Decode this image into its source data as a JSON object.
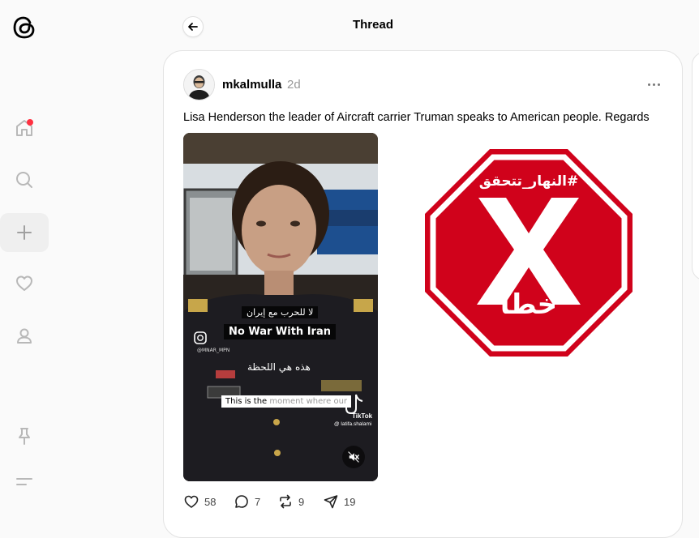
{
  "header": {
    "title": "Thread"
  },
  "sidebar": {
    "items": [
      {
        "name": "home",
        "has_notification": true
      },
      {
        "name": "search"
      },
      {
        "name": "create",
        "active": true
      },
      {
        "name": "activity"
      },
      {
        "name": "profile"
      },
      {
        "name": "pin"
      },
      {
        "name": "menu"
      }
    ]
  },
  "post": {
    "username": "mkalmulla",
    "timestamp": "2d",
    "text": "Lisa Henderson the leader of Aircraft carrier Truman speaks to American people. Regards",
    "video": {
      "caption_arabic_top": "لا للحرب مع إيران",
      "caption_english": "No War With Iran",
      "caption_arabic_mid": "هذه هي اللحظة",
      "subtitle_main": "This is the ",
      "subtitle_dim": "moment where our",
      "watermark": "@MNAR_MPN",
      "tiktok_label": "TikTok",
      "tiktok_user": "@ latifa.shalami"
    },
    "fact_check": {
      "hashtag": "#النهار_تتحقق",
      "verdict": "خطأ",
      "color": "#d0021b"
    },
    "actions": {
      "likes": "58",
      "comments": "7",
      "reposts": "9",
      "shares": "19"
    }
  },
  "colors": {
    "notification_dot": "#ff3040",
    "stop_red": "#d0021b"
  }
}
